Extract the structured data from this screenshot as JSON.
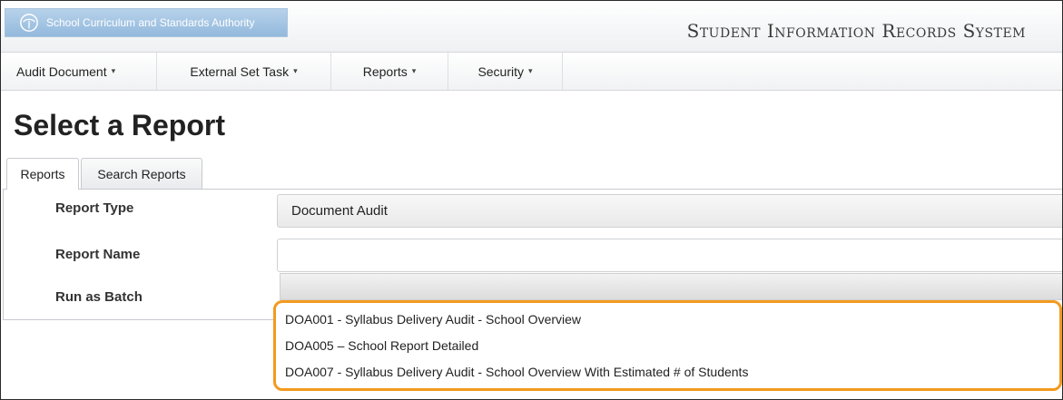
{
  "header": {
    "org_name": "School Curriculum and Standards Authority",
    "logo_icon": "tree-logo-icon",
    "system_title": "Student Information Records System"
  },
  "menu": {
    "items": [
      {
        "label": "Audit Document"
      },
      {
        "label": "External Set Task"
      },
      {
        "label": "Reports"
      },
      {
        "label": "Security"
      }
    ],
    "caret": "▾"
  },
  "page": {
    "title": "Select a Report"
  },
  "tabs": [
    {
      "label": "Reports",
      "active": true
    },
    {
      "label": "Search Reports",
      "active": false
    }
  ],
  "form": {
    "report_type_label": "Report Type",
    "report_type_value": "Document Audit",
    "report_name_label": "Report Name",
    "report_name_value": "",
    "run_as_batch_label": "Run as Batch"
  },
  "dropdown": {
    "options": [
      "DOA001 - Syllabus Delivery Audit - School Overview",
      "DOA005 – School Report Detailed",
      "DOA007 - Syllabus Delivery Audit - School Overview With Estimated # of Students"
    ],
    "highlight_color": "#f39a1f"
  },
  "colors": {
    "logo_bg": "#a5c6e4",
    "accent": "#f39a1f"
  }
}
